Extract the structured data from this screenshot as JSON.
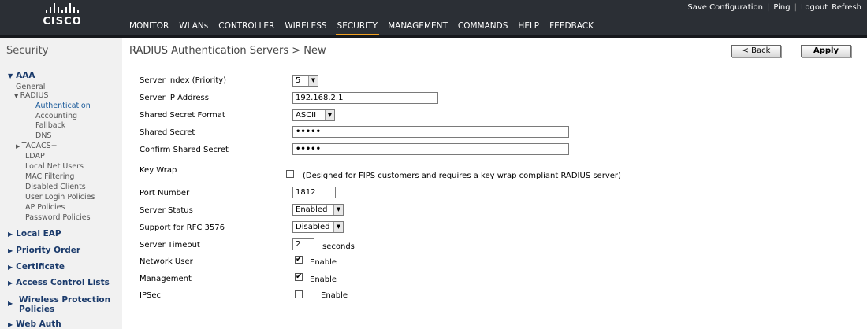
{
  "brand": {
    "name": "CISCO"
  },
  "nav": {
    "items": [
      "MONITOR",
      "WLANs",
      "CONTROLLER",
      "WIRELESS",
      "SECURITY",
      "MANAGEMENT",
      "COMMANDS",
      "HELP",
      "FEEDBACK"
    ],
    "active": "SECURITY",
    "accent_color": "#f2a021"
  },
  "util": {
    "save_configuration": "Save Configuration",
    "ping": "Ping",
    "logout": "Logout",
    "refresh": "Refresh"
  },
  "sidebar": {
    "title": "Security",
    "aaa": "AAA",
    "general": "General",
    "radius": "RADIUS",
    "authentication": "Authentication",
    "accounting": "Accounting",
    "fallback": "Fallback",
    "dns": "DNS",
    "tacacs": "TACACS+",
    "ldap": "LDAP",
    "local_net_users": "Local Net Users",
    "mac_filtering": "MAC Filtering",
    "disabled_clients": "Disabled Clients",
    "user_login_policies": "User Login Policies",
    "ap_policies": "AP Policies",
    "password_policies": "Password Policies",
    "local_eap": "Local EAP",
    "priority_order": "Priority Order",
    "certificate": "Certificate",
    "acl": "Access Control Lists",
    "wireless_protection_1": "Wireless Protection",
    "wireless_protection_2": "Policies",
    "web_auth": "Web Auth"
  },
  "page": {
    "title": "RADIUS Authentication Servers > New",
    "back": "< Back",
    "apply": "Apply"
  },
  "form": {
    "server_index_label": "Server Index (Priority)",
    "server_index_value": "5",
    "server_ip_label": "Server IP Address",
    "server_ip_value": "192.168.2.1",
    "secret_format_label": "Shared Secret Format",
    "secret_format_value": "ASCII",
    "secret_label": "Shared Secret",
    "secret_value": "•••••",
    "confirm_secret_label": "Confirm Shared Secret",
    "confirm_secret_value": "•••••",
    "key_wrap_label": "Key Wrap",
    "key_wrap_checked": false,
    "key_wrap_note": "(Designed for FIPS customers and requires a key wrap compliant RADIUS server)",
    "port_label": "Port Number",
    "port_value": "1812",
    "status_label": "Server Status",
    "status_value": "Enabled",
    "rfc_label": "Support for RFC 3576",
    "rfc_value": "Disabled",
    "timeout_label": "Server Timeout",
    "timeout_value": "2",
    "timeout_unit": "seconds",
    "network_user_label": "Network User",
    "network_user_checked": true,
    "network_user_enable": "Enable",
    "management_label": "Management",
    "management_checked": true,
    "management_enable": "Enable",
    "ipsec_label": "IPSec",
    "ipsec_checked": false,
    "ipsec_enable": "Enable"
  }
}
